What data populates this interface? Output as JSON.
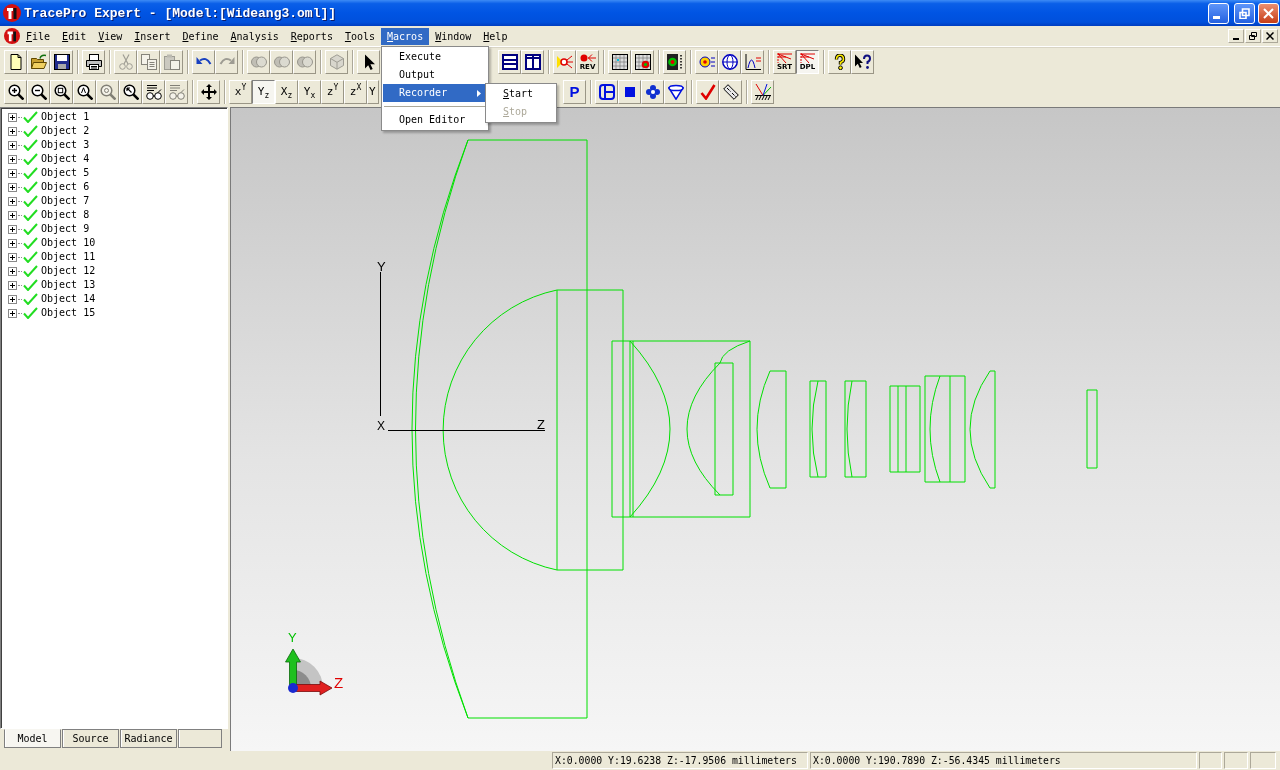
{
  "window": {
    "title": "TracePro Expert - [Model:[Wideang3.oml]]"
  },
  "menu_bar": {
    "items": [
      {
        "label": "File",
        "selected": false
      },
      {
        "label": "Edit",
        "selected": false
      },
      {
        "label": "View",
        "selected": false
      },
      {
        "label": "Insert",
        "selected": false
      },
      {
        "label": "Define",
        "selected": false
      },
      {
        "label": "Analysis",
        "selected": false
      },
      {
        "label": "Reports",
        "selected": false
      },
      {
        "label": "Tools",
        "selected": false
      },
      {
        "label": "Macros",
        "selected": true
      },
      {
        "label": "Window",
        "selected": false
      },
      {
        "label": "Help",
        "selected": false
      }
    ]
  },
  "toolbars": [
    {
      "left_groups": [
        [
          {
            "kind": "icon",
            "disabled": false,
            "pressed": false
          },
          {
            "kind": "icon",
            "disabled": false,
            "pressed": false
          },
          {
            "kind": "icon",
            "disabled": false,
            "pressed": false
          }
        ],
        [
          {
            "kind": "icon",
            "disabled": false,
            "pressed": false
          }
        ],
        [
          {
            "kind": "icon",
            "disabled": true,
            "pressed": false
          },
          {
            "kind": "icon",
            "disabled": true,
            "pressed": false
          },
          {
            "kind": "icon",
            "disabled": true,
            "pressed": false
          }
        ],
        [
          {
            "kind": "icon",
            "disabled": false,
            "pressed": false
          },
          {
            "kind": "icon",
            "disabled": true,
            "pressed": false
          }
        ],
        [
          {
            "kind": "icon",
            "disabled": true,
            "pressed": false
          },
          {
            "kind": "icon",
            "disabled": true,
            "pressed": false
          },
          {
            "kind": "icon",
            "disabled": true,
            "pressed": false
          }
        ],
        [
          {
            "kind": "icon",
            "disabled": true,
            "pressed": false
          }
        ],
        [
          {
            "kind": "icon",
            "disabled": false,
            "pressed": false
          }
        ]
      ],
      "right_groups": [
        [
          {
            "kind": "icon",
            "disabled": false,
            "pressed": false
          },
          {
            "kind": "icon",
            "disabled": false,
            "pressed": false
          }
        ],
        [
          {
            "kind": "icon",
            "disabled": false,
            "pressed": false
          },
          {
            "kind": "captioned",
            "label": "REV",
            "disabled": false,
            "pressed": false
          }
        ],
        [
          {
            "kind": "icon",
            "disabled": false,
            "pressed": false
          },
          {
            "kind": "icon",
            "disabled": false,
            "pressed": false
          }
        ],
        [
          {
            "kind": "icon",
            "disabled": false,
            "pressed": false
          }
        ],
        [
          {
            "kind": "icon",
            "disabled": false,
            "pressed": false
          },
          {
            "kind": "icon",
            "disabled": false,
            "pressed": false
          },
          {
            "kind": "icon",
            "disabled": false,
            "pressed": false
          }
        ],
        [
          {
            "kind": "captioned",
            "label": "SRT",
            "disabled": false,
            "pressed": false
          },
          {
            "kind": "captioned",
            "label": "DPL",
            "disabled": false,
            "pressed": true
          }
        ],
        [
          {
            "kind": "icon",
            "disabled": false,
            "pressed": false
          },
          {
            "kind": "icon",
            "disabled": false,
            "pressed": false
          }
        ]
      ]
    },
    {
      "left_groups": [
        [
          {
            "kind": "icon",
            "disabled": false,
            "pressed": false
          },
          {
            "kind": "icon",
            "disabled": false,
            "pressed": false
          },
          {
            "kind": "icon",
            "disabled": false,
            "pressed": false
          },
          {
            "kind": "icon",
            "disabled": false,
            "pressed": false
          },
          {
            "kind": "icon",
            "disabled": true,
            "pressed": false
          },
          {
            "kind": "icon",
            "disabled": false,
            "pressed": false
          },
          {
            "kind": "icon",
            "disabled": false,
            "pressed": false
          },
          {
            "kind": "icon",
            "disabled": true,
            "pressed": false
          }
        ],
        [
          {
            "kind": "icon",
            "disabled": false,
            "pressed": false
          }
        ],
        [
          {
            "kind": "axes",
            "label": "x$^{Y}$",
            "disabled": false,
            "pressed": false
          },
          {
            "kind": "axes",
            "label": "Y$_{z}$",
            "disabled": false,
            "pressed": true
          },
          {
            "kind": "axes",
            "label": "X$_{z}$",
            "disabled": false,
            "pressed": false
          },
          {
            "kind": "axes",
            "label": "Y$_{x}$",
            "disabled": false,
            "pressed": false
          },
          {
            "kind": "axes",
            "label": "z$^{Y}$",
            "disabled": false,
            "pressed": false
          },
          {
            "kind": "axes",
            "label": "z$^{X}$",
            "disabled": false,
            "pressed": false
          },
          {
            "kind": "axes",
            "label": "Y",
            "disabled": false,
            "pressed": false
          }
        ]
      ],
      "right_groups": [
        [
          {
            "kind": "letter",
            "label": "P",
            "disabled": false,
            "pressed": false
          }
        ],
        [
          {
            "kind": "icon",
            "disabled": false,
            "pressed": false
          },
          {
            "kind": "icon",
            "disabled": false,
            "pressed": false
          },
          {
            "kind": "icon",
            "disabled": false,
            "pressed": false
          },
          {
            "kind": "icon",
            "disabled": false,
            "pressed": false
          }
        ],
        [
          {
            "kind": "icon",
            "disabled": false,
            "pressed": false
          },
          {
            "kind": "icon",
            "disabled": false,
            "pressed": false
          }
        ],
        [
          {
            "kind": "icon",
            "disabled": false,
            "pressed": false
          }
        ]
      ]
    }
  ],
  "model_tree": {
    "items": [
      {
        "label": "Object 1",
        "expanded": false
      },
      {
        "label": "Object 2",
        "expanded": false
      },
      {
        "label": "Object 3",
        "expanded": false
      },
      {
        "label": "Object 4",
        "expanded": false
      },
      {
        "label": "Object 5",
        "expanded": false
      },
      {
        "label": "Object 6",
        "expanded": false
      },
      {
        "label": "Object 7",
        "expanded": false
      },
      {
        "label": "Object 8",
        "expanded": false
      },
      {
        "label": "Object 9",
        "expanded": false
      },
      {
        "label": "Object 10",
        "expanded": false
      },
      {
        "label": "Object 11",
        "expanded": false
      },
      {
        "label": "Object 12",
        "expanded": false
      },
      {
        "label": "Object 13",
        "expanded": false
      },
      {
        "label": "Object 14",
        "expanded": false
      },
      {
        "label": "Object 15",
        "expanded": false
      }
    ]
  },
  "bottom_tabs": [
    {
      "label": "Model",
      "selected": true
    },
    {
      "label": "Source",
      "selected": false
    },
    {
      "label": "Radiance",
      "selected": false
    }
  ],
  "viewport": {
    "axis_labels": {
      "y": "Y",
      "z": "Z",
      "x": "X"
    },
    "triad_labels": {
      "y": "Y",
      "z": "Z"
    }
  },
  "status_bar": {
    "fields": [
      "X:0.0000 Y:19.6238 Z:-17.9506 millimeters",
      "X:0.0000 Y:190.7890 Z:-56.4345 millimeters"
    ]
  },
  "macros_menu": {
    "items": [
      {
        "kind": "item",
        "label": "Execute",
        "selected": false
      },
      {
        "kind": "item",
        "label": "Output",
        "selected": false
      },
      {
        "kind": "submenu",
        "label": "Recorder",
        "selected": true
      },
      {
        "kind": "separator"
      },
      {
        "kind": "item",
        "label": "Open Editor",
        "selected": false
      }
    ]
  },
  "recorder_submenu": {
    "items": [
      {
        "label": "Start",
        "disabled": false
      },
      {
        "label": "Stop",
        "disabled": true
      }
    ]
  }
}
